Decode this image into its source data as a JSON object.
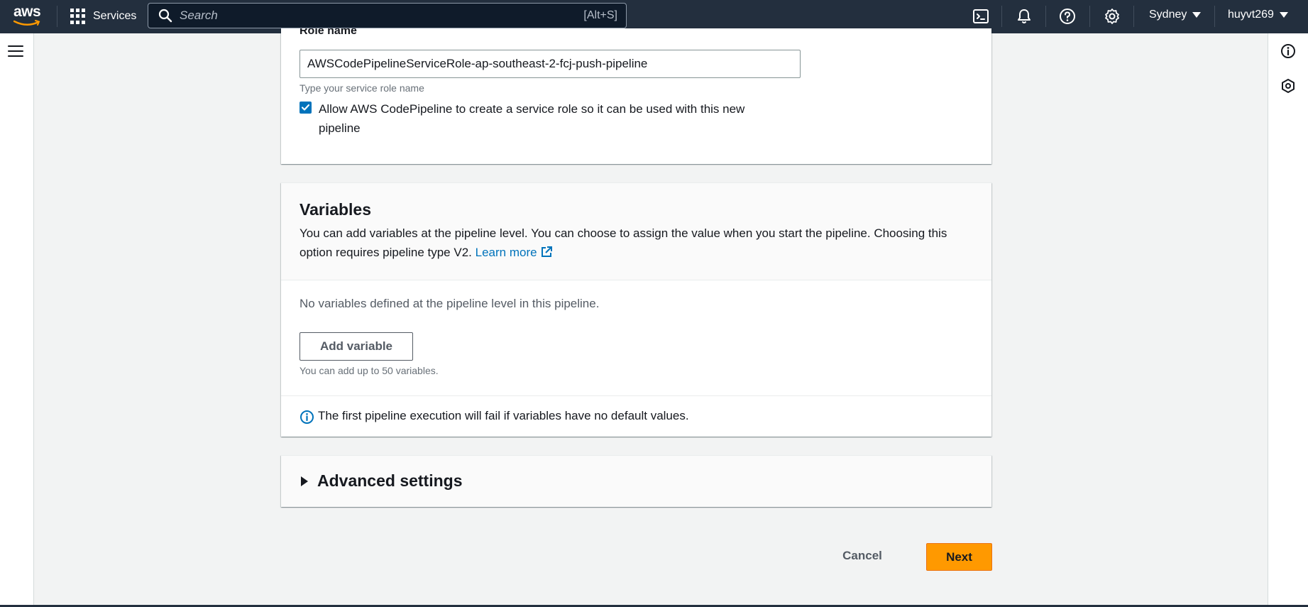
{
  "nav": {
    "logo_text": "aws",
    "services_label": "Services",
    "search_placeholder": "Search",
    "search_shortcut": "[Alt+S]",
    "region": "Sydney",
    "user": "huyvt269"
  },
  "role": {
    "label": "Role name",
    "value": "AWSCodePipelineServiceRole-ap-southeast-2-fcj-push-pipeline",
    "hint": "Type your service role name",
    "checkbox_checked": true,
    "checkbox_label": "Allow AWS CodePipeline to create a service role so it can be used with this new pipeline"
  },
  "variables": {
    "title": "Variables",
    "description": "You can add variables at the pipeline level. You can choose to assign the value when you start the pipeline. Choosing this option requires pipeline type V2.",
    "learn_more": "Learn more",
    "empty_text": "No variables defined at the pipeline level in this pipeline.",
    "add_button": "Add variable",
    "add_hint": "You can add up to 50 variables.",
    "info_text": "The first pipeline execution will fail if variables have no default values."
  },
  "advanced": {
    "title": "Advanced settings"
  },
  "footer": {
    "cancel": "Cancel",
    "next": "Next"
  },
  "colors": {
    "nav_bg": "#232f3e",
    "primary": "#ff9900",
    "link": "#0073bb"
  }
}
